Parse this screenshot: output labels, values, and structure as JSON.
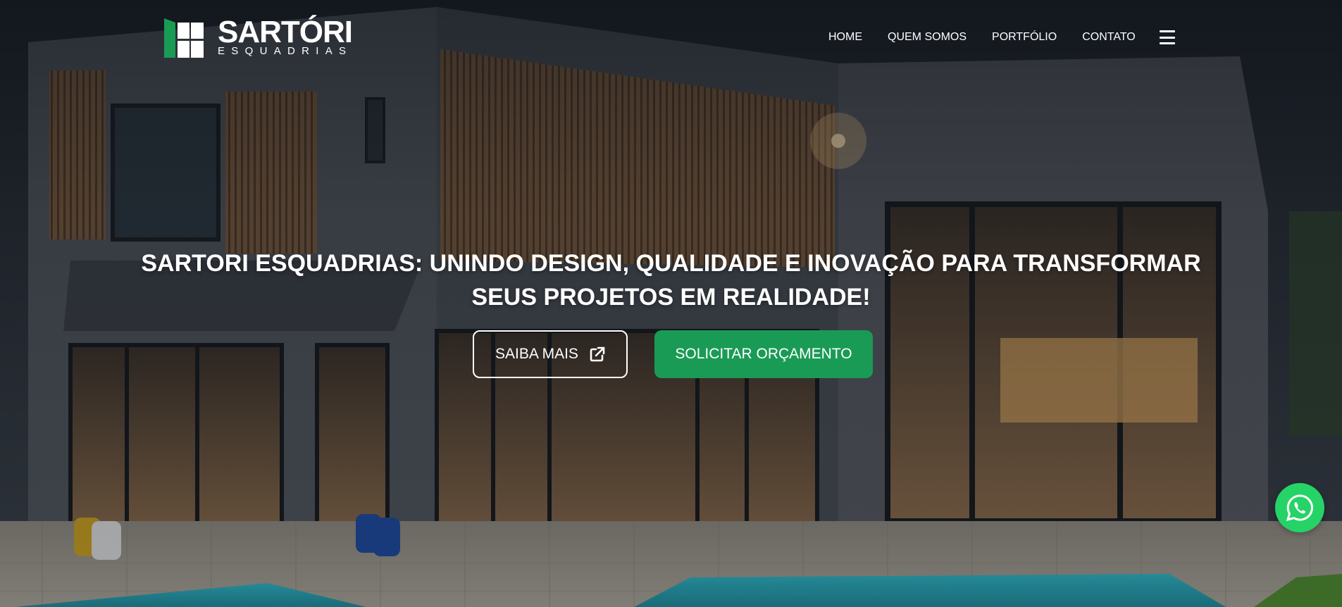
{
  "brand": {
    "name": "SARTÓRI",
    "tagline": "ESQUADRIAS",
    "color": "#1a9b55"
  },
  "nav": {
    "items": [
      {
        "label": "HOME"
      },
      {
        "label": "QUEM SOMOS"
      },
      {
        "label": "PORTFÓLIO"
      },
      {
        "label": "CONTATO"
      }
    ],
    "menu_icon": "hamburger-icon"
  },
  "hero": {
    "headline_bold": "SARTORI ESQUADRIAS:",
    "headline_rest": " UNINDO DESIGN, QUALIDADE E INOVAÇÃO PARA TRANSFORMAR SEUS PROJETOS EM REALIDADE!",
    "buttons": {
      "learn_more": "SAIBA MAIS",
      "learn_more_icon": "external-link-icon",
      "quote": "SOLICITAR ORÇAMENTO"
    },
    "background": "house-photo"
  },
  "whatsapp": {
    "icon": "whatsapp-icon",
    "color": "#25d366"
  }
}
